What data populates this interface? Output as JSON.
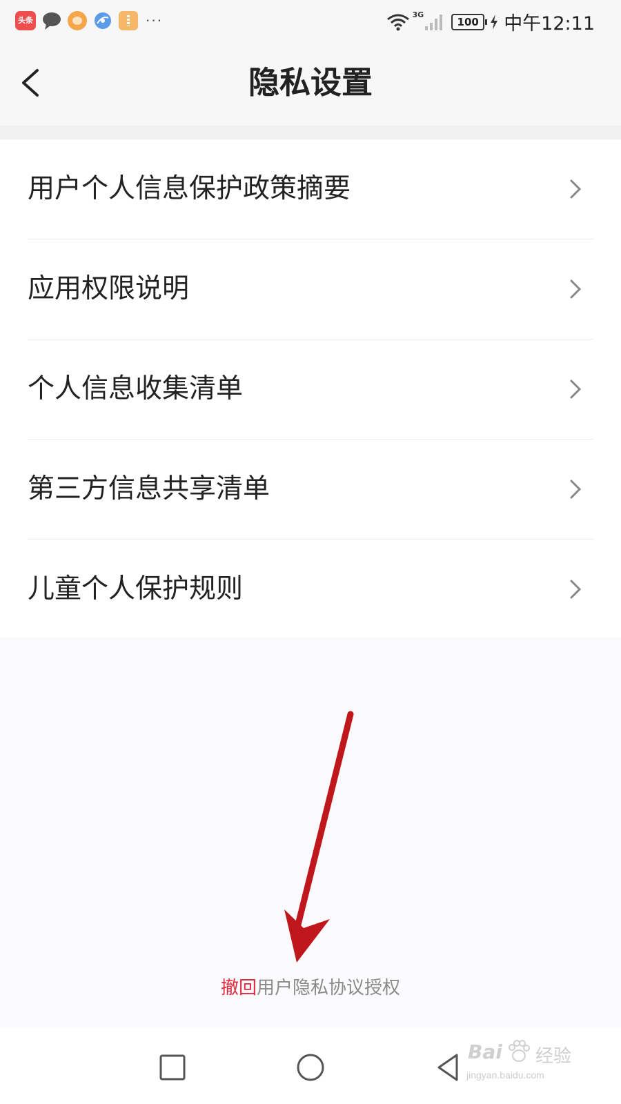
{
  "status_bar": {
    "notification_icons": [
      "toutiao-app-icon",
      "chat-bubble-icon",
      "face-app-icon",
      "browser-app-icon",
      "file-app-icon"
    ],
    "toutiao_label": "头条",
    "more": "···",
    "network": "3G",
    "battery": "100",
    "time": "中午12:11"
  },
  "header": {
    "back_icon": "chevron-left-icon",
    "title": "隐私设置"
  },
  "menu": {
    "items": [
      {
        "label": "用户个人信息保护政策摘要"
      },
      {
        "label": "应用权限说明"
      },
      {
        "label": "个人信息收集清单"
      },
      {
        "label": "第三方信息共享清单"
      },
      {
        "label": "儿童个人保护规则"
      }
    ]
  },
  "footer": {
    "revoke_action": "撤回",
    "revoke_text": "用户隐私协议授权"
  },
  "annotation": {
    "arrow_color": "#c0171c"
  },
  "system_nav": {
    "buttons": [
      "recents-square-icon",
      "home-circle-icon",
      "back-triangle-icon"
    ]
  },
  "watermark": {
    "brand": "Bai",
    "brand_cn": "经验",
    "url": "jingyan.baidu.com"
  },
  "colors": {
    "accent_red": "#e0293f",
    "text_primary": "#222222",
    "text_secondary": "#8a8a8a",
    "background": "#fbfbfd"
  }
}
